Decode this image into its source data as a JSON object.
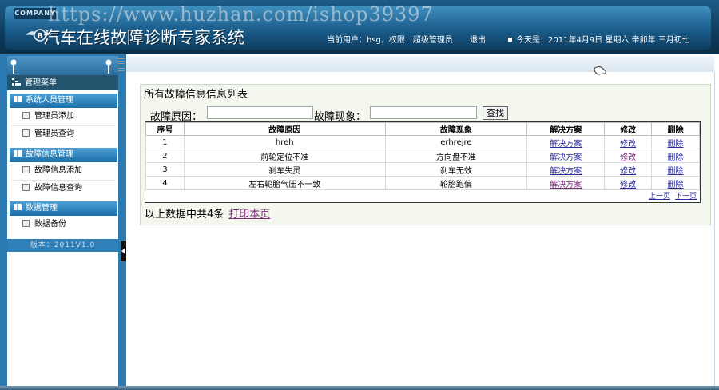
{
  "header": {
    "company": "COMPANY",
    "title": "汽车在线故障诊断专家系统",
    "watermark": "https://www.huzhan.com/ishop39397",
    "user_info": "当前用户：hsg，权限：超级管理员",
    "logout": "退出",
    "date": "今天是：2011年4月9日 星期六 辛卯年 三月初七"
  },
  "sidebar": {
    "menu_title": "管理菜单",
    "groups": [
      {
        "label": "系统人员管理",
        "items": [
          {
            "label": "管理员添加"
          },
          {
            "label": "管理员查询"
          }
        ]
      },
      {
        "label": "故障信息管理",
        "items": [
          {
            "label": "故障信息添加"
          },
          {
            "label": "故障信息查询"
          }
        ]
      },
      {
        "label": "数据管理",
        "items": [
          {
            "label": "数据备份"
          }
        ]
      }
    ],
    "version": "版本：2011V1.0"
  },
  "main": {
    "list_title": "所有故障信息信息列表",
    "search": {
      "cause_label": "故障原因：",
      "cause_value": "",
      "phenomenon_label": "故障现象：",
      "phenomenon_value": "",
      "button": "查找"
    },
    "table": {
      "headers": [
        "序号",
        "故障原因",
        "故障现象",
        "解决方案",
        "修改",
        "删除"
      ],
      "rows": [
        {
          "no": "1",
          "cause": "hreh",
          "phenomenon": "erhrejre",
          "solution": "解决方案",
          "edit": "修改",
          "delete": "删除"
        },
        {
          "no": "2",
          "cause": "前轮定位不准",
          "phenomenon": "方向盘不准",
          "solution": "解决方案",
          "edit": "修改",
          "delete": "删除"
        },
        {
          "no": "3",
          "cause": "刹车失灵",
          "phenomenon": "刹车无效",
          "solution": "解决方案",
          "edit": "修改",
          "delete": "删除"
        },
        {
          "no": "4",
          "cause": "左右轮胎气压不一致",
          "phenomenon": "轮胎跑偏",
          "solution": "解决方案",
          "edit": "修改",
          "delete": "删除"
        }
      ]
    },
    "pager": {
      "prev": "上一页",
      "next": "下一页"
    },
    "summary": "以上数据中共4条",
    "print": "打印本页"
  },
  "colors": {
    "accent": "#1d6fa6",
    "header": "#0f3c5c",
    "link": "#2a2aa0"
  }
}
